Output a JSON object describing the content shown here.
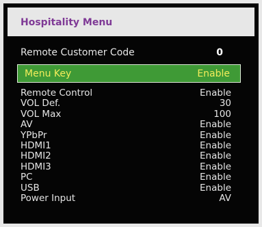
{
  "menu": {
    "title": "Hospitality Menu",
    "customer_code": {
      "label": "Remote Customer Code",
      "value": "0"
    },
    "selected": {
      "label": "Menu Key",
      "value": "Enable"
    },
    "items": [
      {
        "label": "Remote Control",
        "value": "Enable"
      },
      {
        "label": "VOL Def.",
        "value": "30"
      },
      {
        "label": "VOL Max",
        "value": "100"
      },
      {
        "label": "AV",
        "value": "Enable"
      },
      {
        "label": "YPbPr",
        "value": "Enable"
      },
      {
        "label": "HDMI1",
        "value": "Enable"
      },
      {
        "label": "HDMI2",
        "value": "Enable"
      },
      {
        "label": "HDMI3",
        "value": "Enable"
      },
      {
        "label": "PC",
        "value": "Enable"
      },
      {
        "label": "USB",
        "value": "Enable"
      },
      {
        "label": "Power Input",
        "value": "AV"
      }
    ]
  },
  "colors": {
    "background": "#050505",
    "title_bar": "#e7e7e7",
    "title_text": "#7f3a96",
    "highlight": "#3f9a36",
    "highlight_text": "#f2ec5a",
    "item_text": "#e6e6e6"
  }
}
